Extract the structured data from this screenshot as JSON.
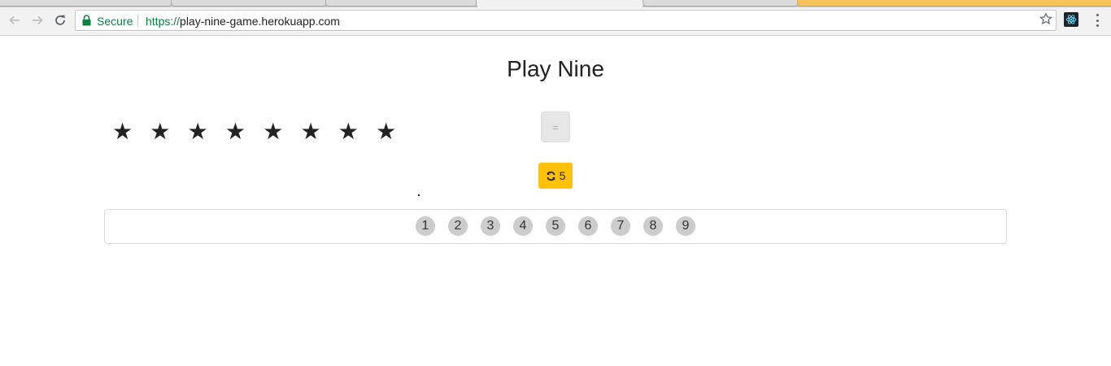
{
  "browser": {
    "secure_label": "Secure",
    "url_scheme": "https://",
    "url_host": "play-nine-game.herokuapp.com"
  },
  "game": {
    "title": "Play Nine",
    "star_count": 8,
    "equals_label": "=",
    "redraw_count": "5",
    "redraw_color": "#ffc107",
    "numbers": [
      "1",
      "2",
      "3",
      "4",
      "5",
      "6",
      "7",
      "8",
      "9"
    ]
  }
}
